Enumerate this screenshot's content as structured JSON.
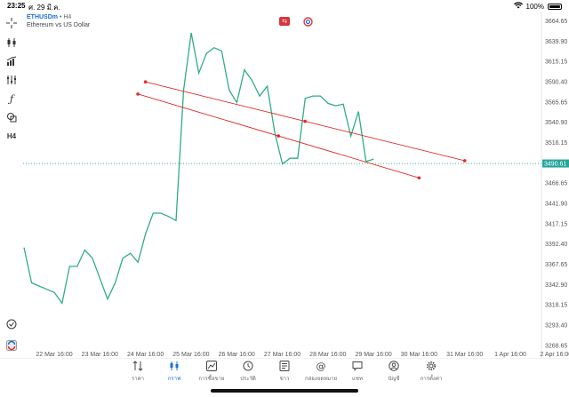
{
  "status_bar": {
    "time": "23:25",
    "date": "ศ. 29 มี.ค.",
    "battery": "100%"
  },
  "symbol": {
    "name": "ETHUSDm",
    "timeframe": "H4",
    "description": "Ethereum vs US Dollar"
  },
  "toolbar": {
    "timeframe_label": "H4",
    "items": [
      "crosshair-icon",
      "candles-icon",
      "indicators-icon",
      "objects-icon",
      "function-icon",
      "shapes-icon",
      "timeframe-icon"
    ]
  },
  "colors": {
    "line": "#2fae84",
    "trend": "#e02a2a",
    "current_price_bg": "#26a69a",
    "accent": "#1a6fd6"
  },
  "chart_data": {
    "type": "line",
    "current_price": "3490.61",
    "y_ticks": [
      "3664.65",
      "3639.90",
      "3615.15",
      "3590.40",
      "3565.65",
      "3540.90",
      "3516.15",
      "3490.61",
      "3466.65",
      "3441.90",
      "3417.15",
      "3392.40",
      "3367.65",
      "3342.90",
      "3318.15",
      "3293.40",
      "3268.65"
    ],
    "x_ticks": [
      "22 Mar 16:00",
      "23 Mar 16:00",
      "24 Mar 16:00",
      "25 Mar 16:00",
      "26 Mar 16:00",
      "27 Mar 16:00",
      "28 Mar 16:00",
      "29 Mar 16:00",
      "30 Mar 16:00",
      "31 Mar 16:00",
      "1 Apr 16:00",
      "2 Apr 16:00"
    ],
    "series": [
      {
        "values": [
          3388,
          3345,
          3341,
          3337,
          3333,
          3320,
          3365,
          3365,
          3385,
          3375,
          3350,
          3325,
          3345,
          3375,
          3381,
          3370,
          3405,
          3430,
          3430,
          3426,
          3421,
          3580,
          3650,
          3601,
          3625,
          3632,
          3628,
          3580,
          3565,
          3605,
          3592,
          3573,
          3585,
          3528,
          3490,
          3497,
          3497,
          3570,
          3573,
          3573,
          3564,
          3561,
          3563,
          3524,
          3554,
          3493,
          3496
        ]
      }
    ],
    "trendlines": [
      {
        "start": [
          "24 Mar 16:00",
          3590.2
        ],
        "end": [
          "31 Mar 16:00",
          3494.0
        ]
      },
      {
        "start": [
          "24 Mar 12:00",
          3575.4
        ],
        "end": [
          "30 Mar 16:00",
          3473.0
        ]
      }
    ],
    "ylim": [
      3263,
      3675
    ]
  },
  "nav": [
    {
      "label": "ราคา",
      "icon": "quotes-icon"
    },
    {
      "label": "กราฟ",
      "icon": "chart-icon",
      "active": true
    },
    {
      "label": "การซื้อขาย",
      "icon": "trade-icon"
    },
    {
      "label": "ประวัติ",
      "icon": "history-icon"
    },
    {
      "label": "ข่าว",
      "icon": "news-icon"
    },
    {
      "label": "กล่องจดหมาย",
      "icon": "mailbox-icon"
    },
    {
      "label": "แชท",
      "icon": "chat-icon"
    },
    {
      "label": "บัญชี",
      "icon": "account-icon"
    },
    {
      "label": "การตั้งค่า",
      "icon": "settings-icon"
    }
  ]
}
